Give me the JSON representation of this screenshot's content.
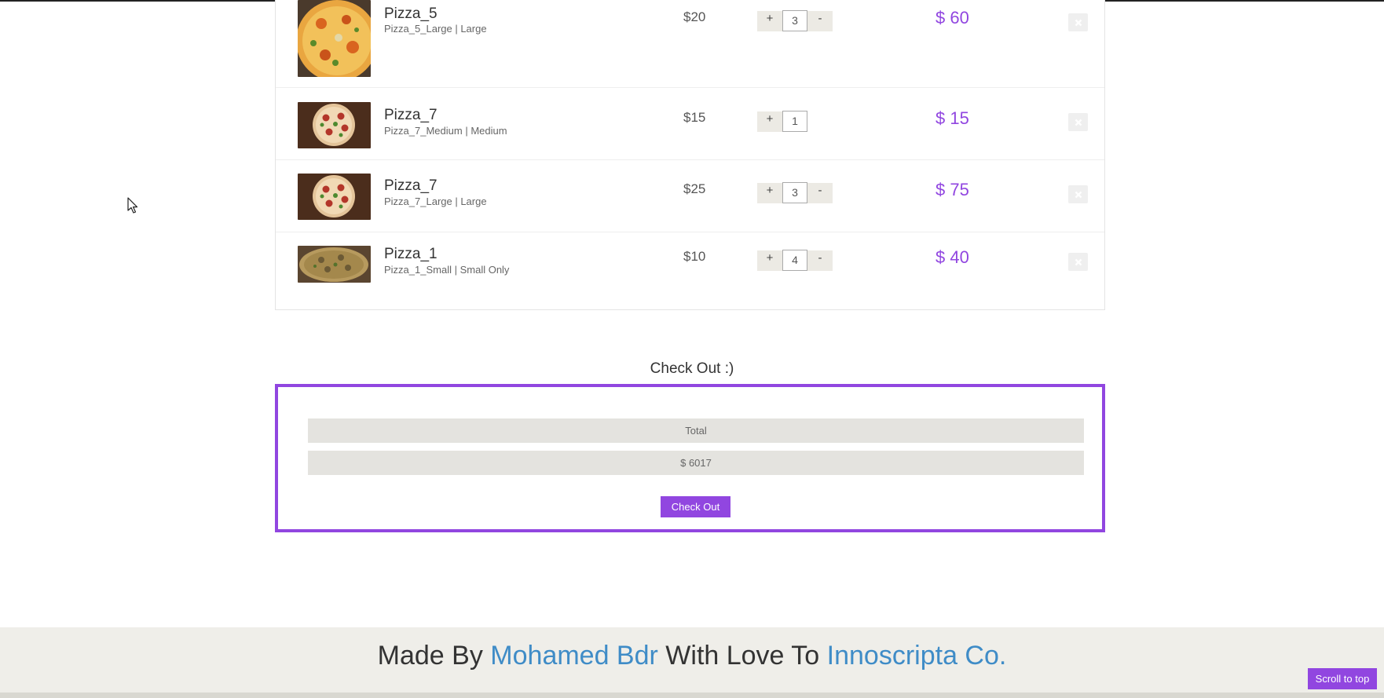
{
  "cart": {
    "items": [
      {
        "name": "Pizza_5",
        "description": "Pizza_5_Large | Large",
        "price": "$20",
        "quantity": "3",
        "subtotal": "$ 60",
        "has_minus": true,
        "image": "pizza-cheese-toppings"
      },
      {
        "name": "Pizza_7",
        "description": "Pizza_7_Medium | Medium",
        "price": "$15",
        "quantity": "1",
        "subtotal": "$ 15",
        "has_minus": false,
        "image": "pizza-pepperoni-basil"
      },
      {
        "name": "Pizza_7",
        "description": "Pizza_7_Large | Large",
        "price": "$25",
        "quantity": "3",
        "subtotal": "$ 75",
        "has_minus": true,
        "image": "pizza-pepperoni-basil"
      },
      {
        "name": "Pizza_1",
        "description": "Pizza_1_Small | Small Only",
        "price": "$10",
        "quantity": "4",
        "subtotal": "$ 40",
        "has_minus": true,
        "image": "pizza-mushroom"
      }
    ],
    "plus_label": "+",
    "minus_label": "-"
  },
  "checkout": {
    "title": "Check Out :)",
    "total_label": "Total",
    "total_value": "$ 6017",
    "button_label": "Check Out"
  },
  "footer": {
    "made_by": "Made By",
    "author": "Mohamed Bdr",
    "with_love": "With Love To",
    "company": "Innoscripta Co."
  },
  "scroll_top_label": "Scroll to top",
  "colors": {
    "accent": "#9146e0",
    "link": "#3f8cc7",
    "footer_bg": "#efeee9"
  }
}
